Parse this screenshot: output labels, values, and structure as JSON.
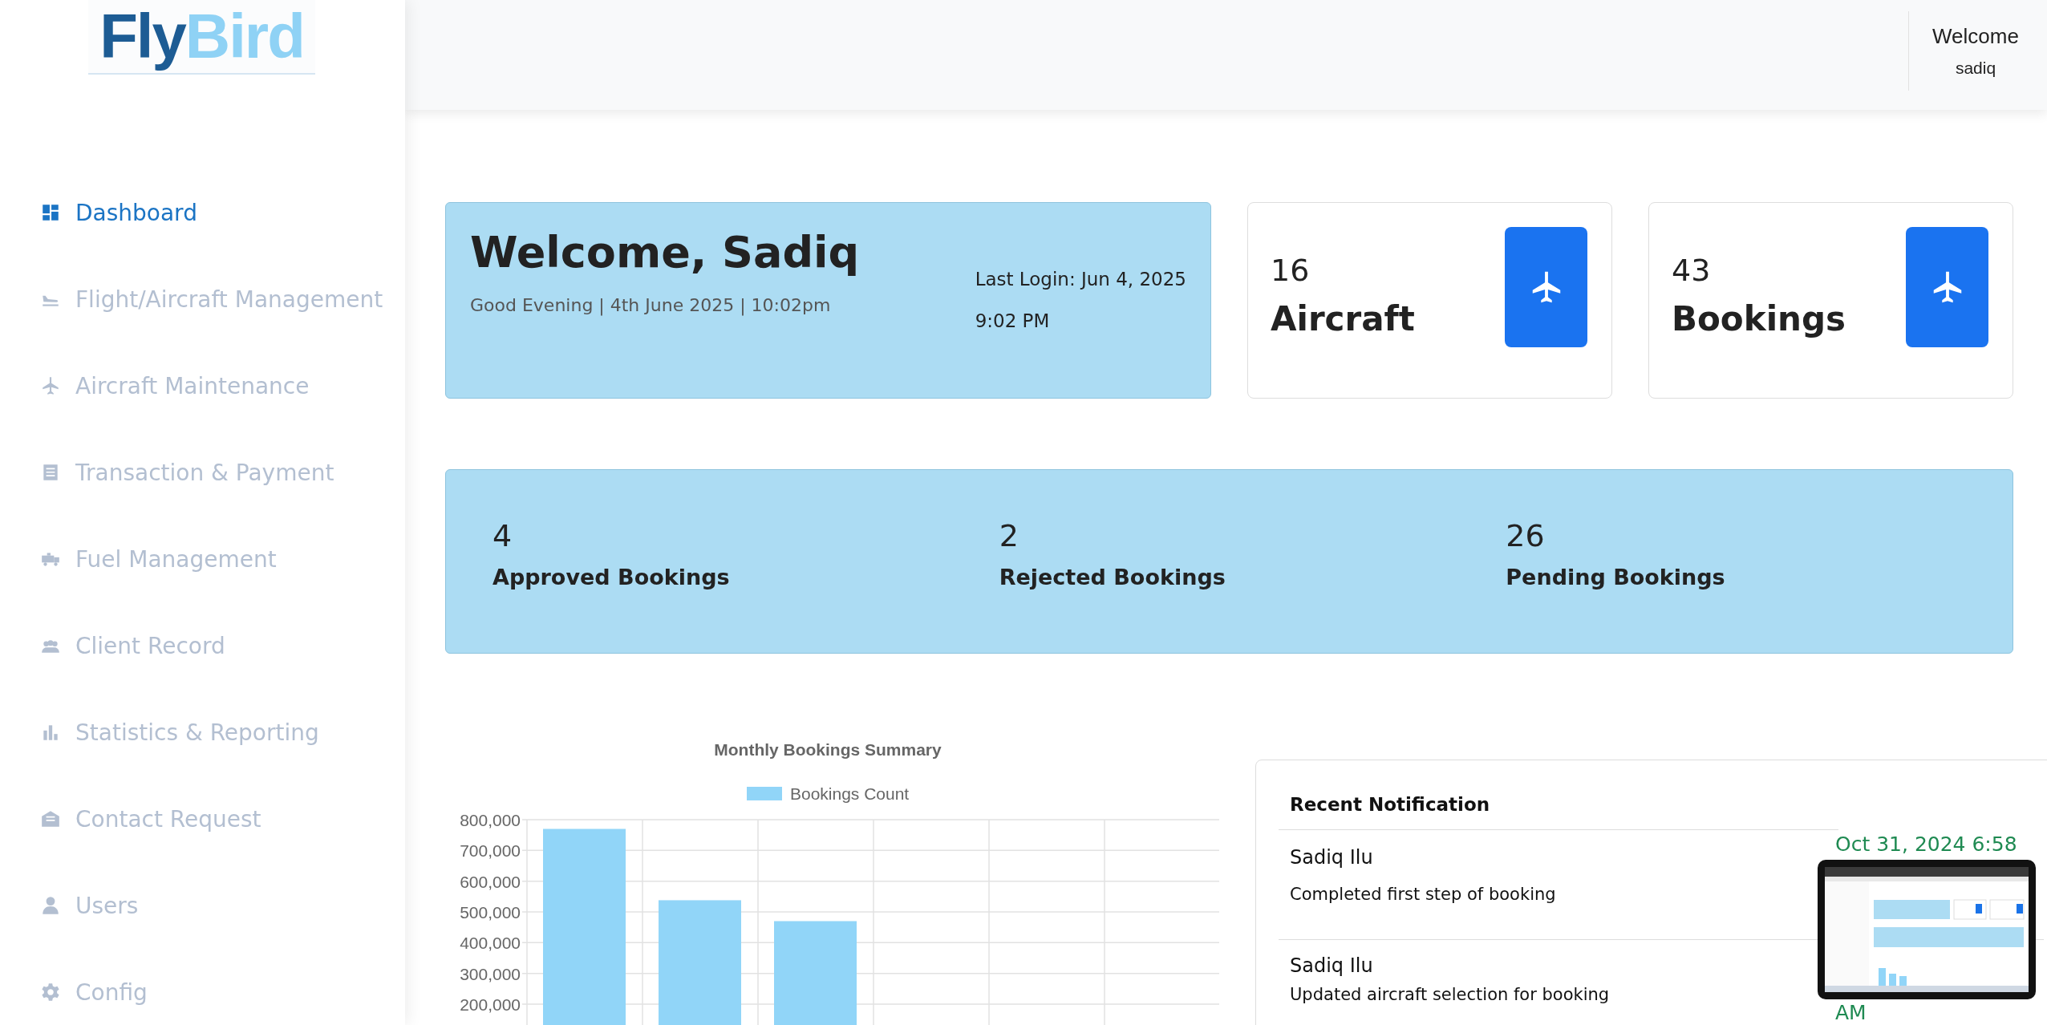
{
  "logo": {
    "part_dark": "Fly",
    "part_light": "Bird"
  },
  "sidebar": {
    "items": [
      {
        "label": "Dashboard",
        "kind": "grid",
        "selected": true
      },
      {
        "label": "Flight/Aircraft Management",
        "kind": "landing",
        "selected": false
      },
      {
        "label": "Aircraft Maintenance",
        "kind": "plane",
        "selected": false
      },
      {
        "label": "Transaction & Payment",
        "kind": "receipt",
        "selected": false
      },
      {
        "label": "Fuel Management",
        "kind": "truck",
        "selected": false
      },
      {
        "label": "Client Record",
        "kind": "group",
        "selected": false
      },
      {
        "label": "Statistics & Reporting",
        "kind": "chart",
        "selected": false
      },
      {
        "label": "Contact Request",
        "kind": "mail",
        "selected": false
      },
      {
        "label": "Users",
        "kind": "user",
        "selected": false
      },
      {
        "label": "Config",
        "kind": "gear",
        "selected": false
      }
    ]
  },
  "header": {
    "welcome": "Welcome",
    "user": "sadiq"
  },
  "welcome_card": {
    "title": "Welcome, Sadiq",
    "subtitle": "Good Evening | 4th June 2025 | 10:02pm",
    "last_login": "Last Login: Jun 4, 2025",
    "last_login_time": "9:02 PM"
  },
  "stat_cards": [
    {
      "value": "16",
      "label": "Aircraft"
    },
    {
      "value": "43",
      "label": "Bookings"
    }
  ],
  "booking_stats": [
    {
      "value": "4",
      "label": "Approved Bookings"
    },
    {
      "value": "2",
      "label": "Rejected Bookings"
    },
    {
      "value": "26",
      "label": "Pending Bookings"
    }
  ],
  "chart": {
    "chart_data": {
      "type": "bar",
      "title": "Monthly Bookings Summary",
      "series": [
        {
          "name": "Bookings Count",
          "color": "#91d5f8",
          "values": [
            770000,
            538000,
            470000,
            null,
            null,
            null
          ]
        }
      ],
      "yticks": [
        {
          "value": 200000,
          "label": "200,000"
        },
        {
          "value": 300000,
          "label": "300,000"
        },
        {
          "value": 400000,
          "label": "400,000"
        },
        {
          "value": 500000,
          "label": "500,000"
        },
        {
          "value": 600000,
          "label": "600,000"
        },
        {
          "value": 700000,
          "label": "700,000"
        },
        {
          "value": 800000,
          "label": "800,000"
        }
      ],
      "ylim": [
        0,
        800000
      ],
      "grid": true
    }
  },
  "notifications": {
    "title": "Recent Notification",
    "items": [
      {
        "name": "Sadiq Ilu",
        "message": "Completed first step of booking",
        "time": "Oct 31, 2024 6:58"
      },
      {
        "name": "Sadiq Ilu",
        "message": "Updated aircraft selection for booking",
        "time": "AM"
      }
    ]
  }
}
